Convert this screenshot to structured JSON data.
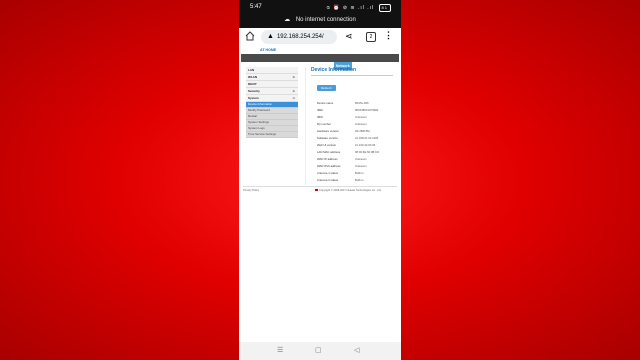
{
  "status_bar": {
    "time": "5:47",
    "icons": "⦸ ⏰ ⊘ ≋ .ıl .ıl",
    "battery": "81",
    "offline_text": "No internet connection"
  },
  "browser": {
    "url": "192.168.254.254/",
    "tab_count": "2"
  },
  "web": {
    "header_logo": "AT HOME",
    "nav": [
      "Home",
      "WiFi Settings",
      "Statistics",
      "SMS",
      "Network"
    ],
    "sidebar": {
      "sections": [
        {
          "label": "LAN",
          "expandable": false
        },
        {
          "label": "WLAN",
          "expandable": true
        },
        {
          "label": "DHCP",
          "expandable": false
        },
        {
          "label": "Security",
          "expandable": true
        },
        {
          "label": "System",
          "expandable": true
        }
      ],
      "sub_items": [
        "Device Information",
        "Modify Password",
        "Restart",
        "System Settings",
        "System Logs",
        "Time Service Settings"
      ],
      "active_sub": "Device Information"
    },
    "page_title": "Device Information",
    "refresh_label": "Refresh",
    "rows": [
      {
        "key": "Device name",
        "value": "B315s-936"
      },
      {
        "key": "IMEI",
        "value": "866438031070982"
      },
      {
        "key": "IMSI",
        "value": "Unknown"
      },
      {
        "key": "My number",
        "value": "Unknown"
      },
      {
        "key": "Hardware version",
        "value": "WL1B315M"
      },
      {
        "key": "Software version",
        "value": "21.328.01.00.1284"
      },
      {
        "key": "Web UI version",
        "value": "21.100.44.00.03"
      },
      {
        "key": "LAN MAC address",
        "value": "08:00:6E:60:3B:CD"
      },
      {
        "key": "WAN IP address",
        "value": "Unknown"
      },
      {
        "key": "WAN IPv6 address",
        "value": "Unknown"
      },
      {
        "key": "Antenna 1 status",
        "value": "Built-in"
      },
      {
        "key": "Antenna 2 status",
        "value": "Built-in"
      }
    ],
    "footer_left": "Privacy Policy",
    "footer_right": "Copyright © 2006-2017 Huawei Technologies Co., Ltd."
  },
  "system_nav": {
    "recent": "☰",
    "home": "▢",
    "back": "◁"
  }
}
